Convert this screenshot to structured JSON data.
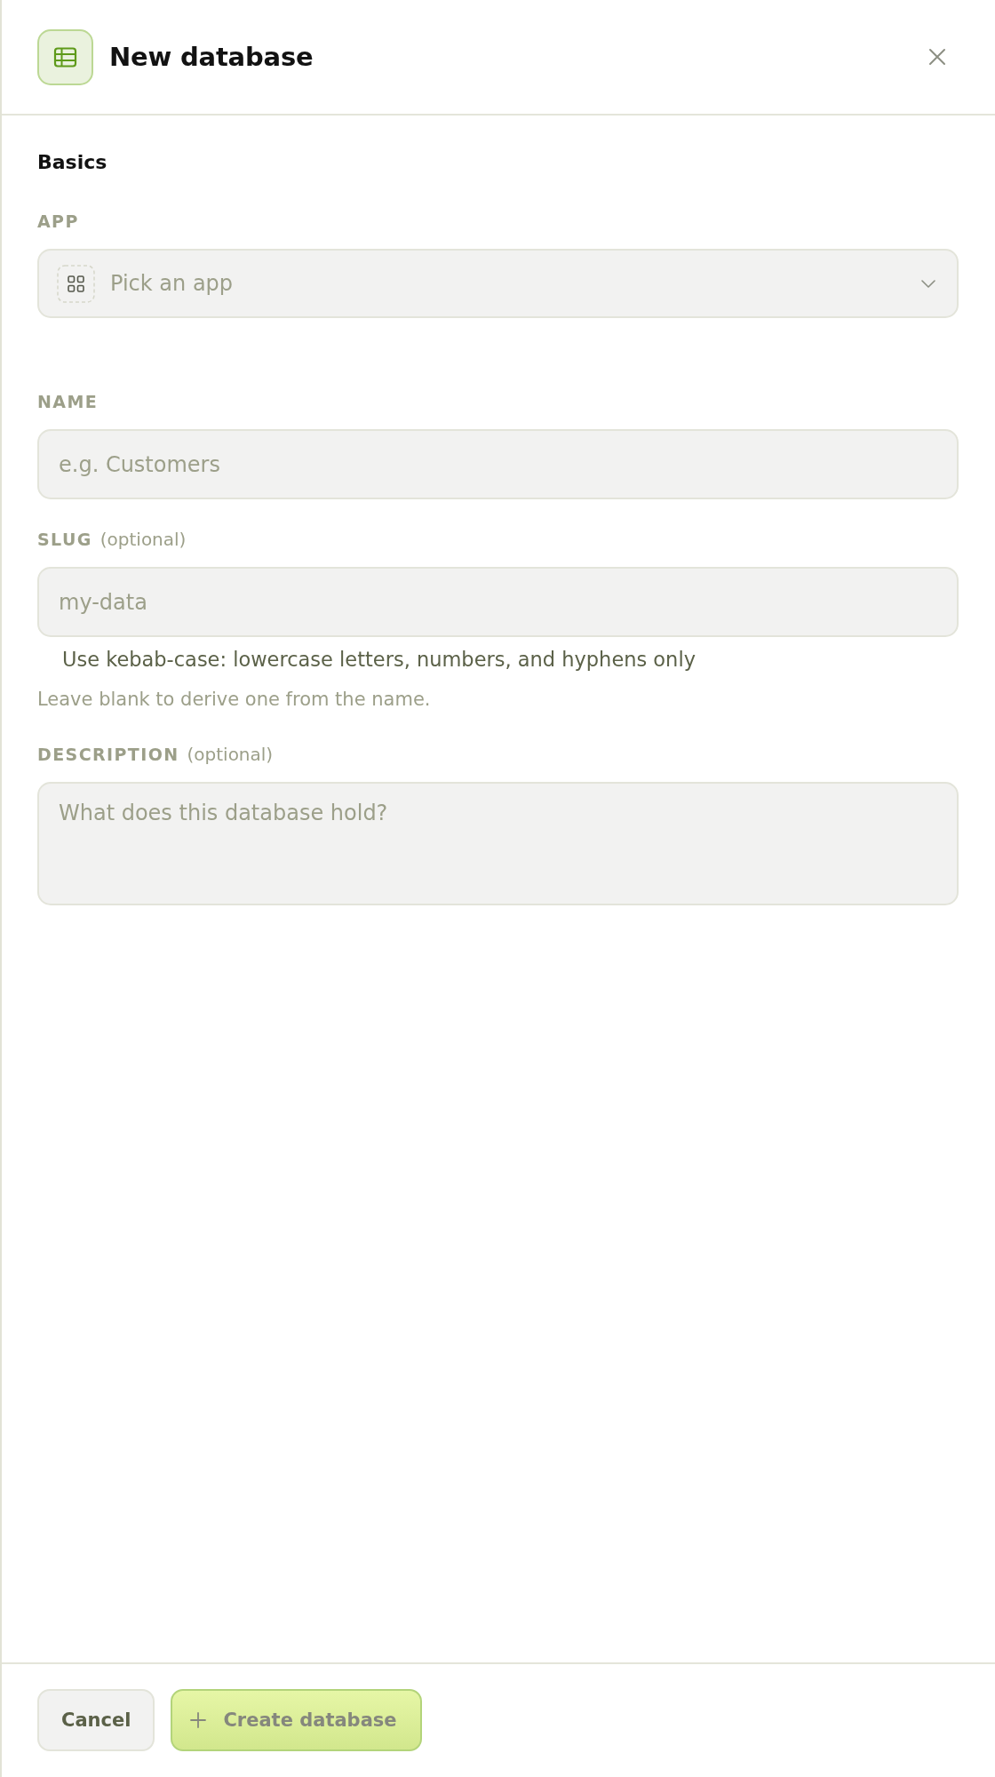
{
  "dialog": {
    "title": "New database"
  },
  "section": {
    "title": "Basics"
  },
  "fields": [
    {
      "kind": "select",
      "label": "APP",
      "placeholder": "Pick an app"
    },
    {
      "kind": "text",
      "label": "NAME",
      "placeholder": "e.g. Customers"
    },
    {
      "kind": "text",
      "label": "SLUG",
      "note": "(optional)",
      "placeholder": "my-data",
      "hint": "Use kebab-case: lowercase letters, numbers, and hyphens only",
      "help": "Leave blank to derive one from the name."
    },
    {
      "kind": "textarea",
      "label": "DESCRIPTION",
      "note": "(optional)",
      "placeholder": "What does this database hold?"
    }
  ],
  "buttons": [
    {
      "kind": "secondary",
      "label": "Cancel",
      "disabled": false
    },
    {
      "kind": "primary",
      "label": "Create database",
      "disabled": true
    }
  ]
}
